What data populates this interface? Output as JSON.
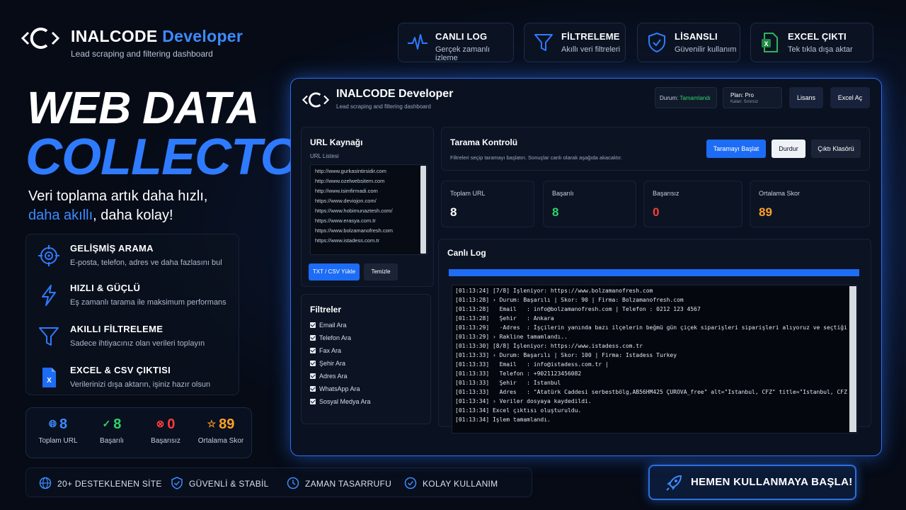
{
  "brand": {
    "name_part1": "INALCODE",
    "name_part2": "Developer",
    "subtitle": "Lead scraping and filtering dashboard"
  },
  "hero": {
    "line1": "WEB DATA",
    "line2": "COLLECTOR",
    "tagline1": "Veri toplama artık daha hızlı,",
    "tagline2_accent": "daha akıllı",
    "tagline2_rest": ", daha kolay!"
  },
  "left_features": [
    {
      "icon": "target-icon",
      "title": "GELİŞMİŞ ARAMA",
      "desc": "E-posta, telefon, adres ve daha fazlasını bul"
    },
    {
      "icon": "lightning-icon",
      "title": "HIZLI & GÜÇLÜ",
      "desc": "Eş zamanlı tarama ile maksimum performans"
    },
    {
      "icon": "filter-icon",
      "title": "AKILLI FİLTRELEME",
      "desc": "Sadece ihtiyacınız olan verileri toplayın"
    },
    {
      "icon": "excel-file-icon",
      "title": "EXCEL & CSV ÇIKTISI",
      "desc": "Verilerinizi dışa aktarın, işiniz hazır olsun"
    }
  ],
  "summary_stats": [
    {
      "icon": "globe-icon",
      "value": "8",
      "label": "Toplam URL",
      "color": "#3d8bff"
    },
    {
      "icon": "check-circle-icon",
      "value": "8",
      "label": "Başarılı",
      "color": "#2fd36b"
    },
    {
      "icon": "x-circle-icon",
      "value": "0",
      "label": "Başarısız",
      "color": "#ff3b3b"
    },
    {
      "icon": "star-icon",
      "value": "89",
      "label": "Ortalama Skor",
      "color": "#ffa126"
    }
  ],
  "bottom_bar": [
    {
      "icon": "globe-icon",
      "label": "20+ DESTEKLENEN SİTE"
    },
    {
      "icon": "shield-check-icon",
      "label": "GÜVENLİ & STABİL"
    },
    {
      "icon": "clock-icon",
      "label": "ZAMAN TASARRUFU"
    },
    {
      "icon": "check-circle-icon",
      "label": "KOLAY KULLANIM"
    }
  ],
  "cta": {
    "icon": "rocket-icon",
    "label": "HEMEN KULLANMAYA BAŞLA!"
  },
  "top_cards": [
    {
      "icon": "pulse-icon",
      "title": "CANLI LOG",
      "desc": "Gerçek zamanlı izleme"
    },
    {
      "icon": "filter-icon",
      "title": "FİLTRELEME",
      "desc": "Akıllı veri filtreleri"
    },
    {
      "icon": "shield-check-icon",
      "title": "LİSANSLI",
      "desc": "Güvenilir kullanım"
    },
    {
      "icon": "excel-file-icon",
      "title": "EXCEL ÇIKTI",
      "desc": "Tek tıkla dışa aktar"
    }
  ],
  "app": {
    "title": "INALCODE Developer",
    "subtitle": "Lead scraping and filtering dashboard",
    "status_label": "Durum:",
    "status_value": "Tamamlandı",
    "status_color": "#2fd36b",
    "plan_label": "Plan: Pro",
    "plan_remaining": "Kalan: Sınırsız",
    "license_button": "Lisans",
    "excel_open_button": "Excel Aç",
    "url_panel": {
      "title": "URL Kaynağı",
      "list_label": "URL Listesi",
      "urls": [
        "http://www.gurkasintirsidir.com",
        "http://www.ozelwebsitem.com",
        "http://www.isimfirmadi.com",
        "https://www.deviojon.com/",
        "https://www.hobimunaztesh.com/",
        "https://www.erasya.com.tr",
        "https://www.bolzamanofresh.com",
        "https://www.istadess.com.tr"
      ],
      "upload_button": "TXT / CSV Yükle",
      "clear_button": "Temizle"
    },
    "filters_panel": {
      "title": "Filtreler",
      "items": [
        "Email Ara",
        "Telefon Ara",
        "Fax Ara",
        "Şehir Ara",
        "Adres Ara",
        "WhatsApp Ara",
        "Sosyal Medya Ara"
      ]
    },
    "scan_control": {
      "title": "Tarama Kontrolü",
      "desc": "Filtreleri seçip taramayı başlatın. Sonuçlar canlı olarak aşağıda akacaktır.",
      "start_button": "Taramayı Başlat",
      "stop_button": "Durdur",
      "output_folder_button": "Çıktı Klasörü"
    },
    "stats": [
      {
        "label": "Toplam URL",
        "value": "8",
        "color": "#ffffff"
      },
      {
        "label": "Başarılı",
        "value": "8",
        "color": "#2fd36b"
      },
      {
        "label": "Başarısız",
        "value": "0",
        "color": "#ff3b3b"
      },
      {
        "label": "Ortalama Skor",
        "value": "89",
        "color": "#ffa126"
      }
    ],
    "live_log": {
      "title": "Canlı Log",
      "progress": 1.0,
      "lines": [
        "[01:13:24] [7/8] İşleniyor: https://www.bolzamanofresh.com",
        "[01:13:28] › Durum: Başarılı | Skor: 90 | Firma: Bolzamanofresh.com",
        "[01:13:28]   Email   : info@bolzamanofresh.com | Telefon : 0212 123 4567",
        "[01:13:28]   Şehir   : Ankara",
        "[01:13:29]   ·Adres  : İşçilerin yanında bazı ilçelerin beğmü gün çiçek siparişleri siparişleri alıyoruz ve seçtiğiniz zaman",
        "[01:13:29] › Rakline tamamlandı..",
        "[01:13:30] [8/8] İşleniyor: https://www.istadess.com.tr",
        "[01:13:33] › Durum: Başarılı | Skor: 100 | Firma: Istadess Turkey",
        "[01:13:33]   Email   : info@istadess.com.tr |",
        "[01:13:33]   Telefon : +9021123456082",
        "[01:13:33]   Şehir   : İstanbul",
        "[01:13:33]   Adres   : \"Atatürk Caddesi serbestbölg,AB56HM425 ÇUROVA_free\" alt=\"Istanbul, CFZ\" title=\"Istanbul, CFZ\"",
        "[01:13:34] › Veriler dosyaya kaydedildi.",
        "[01:13:34] Excel çıktısı oluşturuldu.",
        "[01:13:34] İşlem tamamlandı."
      ]
    }
  }
}
